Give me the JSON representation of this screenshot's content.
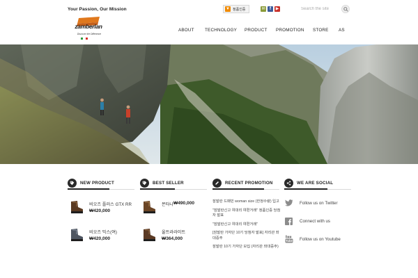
{
  "header": {
    "tagline": "Your Passion, Our Mission",
    "logo": {
      "word": "zamberlan",
      "sub": "Discover the Difference"
    },
    "store_button": "정품인증",
    "search_placeholder": "Search the site",
    "nav": [
      "ABOUT",
      "TECHNOLOGY",
      "PRODUCT",
      "PROMOTION",
      "STORE",
      "AS"
    ]
  },
  "colors": {
    "accent_orange": "#f08a00",
    "brand_orange": "#e0781c",
    "dark": "#2a2a2a",
    "social_icon": "#8c8c8c"
  },
  "widgets": {
    "new_product": {
      "title": "NEW PRODUCT",
      "icon": "tag-icon",
      "items": [
        {
          "name": "비오즈 플러스 GTX RR",
          "price": "₩420,000"
        },
        {
          "name": "비오즈 믹스(여)",
          "price": "₩420,000"
        }
      ]
    },
    "best_seller": {
      "title": "BEST SELLER",
      "icon": "tag-icon",
      "items": [
        {
          "name": "몬타나",
          "price": "₩490,000"
        },
        {
          "name": "울트라라이트",
          "price": "₩364,000"
        }
      ]
    },
    "recent_promotion": {
      "title": "RECENT PROMOTION",
      "icon": "pencil-icon",
      "items": [
        "잠발란 드패민 woman size (한정수량) 입고",
        "\"잠발란신고 여대리 여편거래\" 정품인증 당첨자 발표",
        "\"잠발란신고 여대리 여편거래\"",
        "[잠발란 가자단 10기 당첨자 발표] 자리관 좌대증주",
        "잠발란 10기 가자단 모집 (자리관 좌대증주)"
      ]
    },
    "we_are_social": {
      "title": "WE ARE SOCIAL",
      "icon": "share-icon",
      "links": [
        {
          "label": "Follow us on Twitter",
          "icon": "twitter-icon"
        },
        {
          "label": "Connect with us",
          "icon": "facebook-icon"
        },
        {
          "label": "Follow us on Youtube",
          "icon": "youtube-icon"
        }
      ]
    }
  }
}
